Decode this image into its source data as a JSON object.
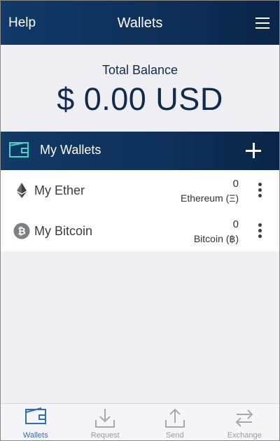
{
  "header": {
    "help": "Help",
    "title": "Wallets",
    "menu_icon": "hamburger-menu-icon"
  },
  "balance": {
    "label": "Total Balance",
    "amount": "$ 0.00 USD"
  },
  "section": {
    "title": "My Wallets",
    "add_icon": "plus-icon",
    "wallet_icon": "wallet-icon"
  },
  "wallets": [
    {
      "name": "My Ether",
      "balance": "0",
      "unit": "Ethereum (Ξ)",
      "icon": "ethereum-icon"
    },
    {
      "name": "My Bitcoin",
      "balance": "0",
      "unit": "Bitcoin (฿)",
      "icon": "bitcoin-icon"
    }
  ],
  "nav": [
    {
      "label": "Wallets",
      "icon": "wallet-icon",
      "active": true
    },
    {
      "label": "Request",
      "icon": "download-icon",
      "active": false
    },
    {
      "label": "Send",
      "icon": "upload-icon",
      "active": false
    },
    {
      "label": "Exchange",
      "icon": "exchange-arrows-icon",
      "active": false
    }
  ],
  "colors": {
    "accent": "#2f6fb3",
    "header": "#0d2f58",
    "wallet_icon_teal": "#4fd1c5"
  }
}
